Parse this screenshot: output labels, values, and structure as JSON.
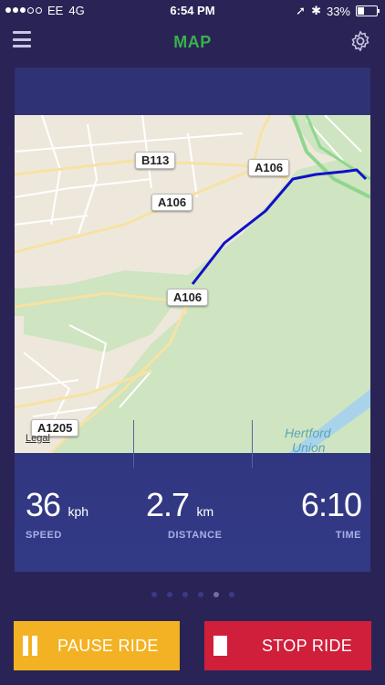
{
  "status_bar": {
    "carrier": "EE",
    "network": "4G",
    "time": "6:54 PM",
    "battery": "33%",
    "battery_level": 0.33
  },
  "header": {
    "title": "MAP",
    "title_color": "#37b24a",
    "menu_icon": "hamburger-icon",
    "settings_icon": "gear-icon"
  },
  "map": {
    "road_labels": [
      "B113",
      "A106",
      "A106",
      "A106",
      "A1205"
    ],
    "place_label_line1": "Hertford",
    "place_label_line2": "Union",
    "legal": "Legal",
    "route_color": "#1010c8"
  },
  "stats": {
    "speed": {
      "value": "36",
      "unit": "kph",
      "label": "SPEED"
    },
    "distance": {
      "value": "2.7",
      "unit": "km",
      "label": "DISTANCE"
    },
    "time": {
      "value": "6:10",
      "label": "TIME"
    }
  },
  "pager": {
    "count": 6,
    "active_index": 4
  },
  "actions": {
    "pause_label": "PAUSE RIDE",
    "stop_label": "STOP RIDE",
    "pause_color": "#f3b223",
    "stop_color": "#cf1f3b"
  }
}
